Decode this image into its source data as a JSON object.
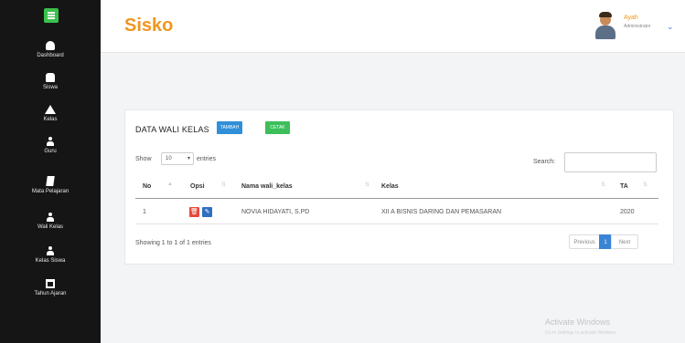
{
  "app": {
    "brand": "Sisko"
  },
  "user": {
    "name": "Ayah",
    "role": "Administrator"
  },
  "sidebar": {
    "items": [
      {
        "label": "Dashboard",
        "icon": "dashboard-icon"
      },
      {
        "label": "Siswa",
        "icon": "users-icon"
      },
      {
        "label": "Kelas",
        "icon": "home-icon"
      },
      {
        "label": "Guru",
        "icon": "user-icon"
      },
      {
        "label": "Mata Pelajaran",
        "icon": "book-icon"
      },
      {
        "label": "Wali Kelas",
        "icon": "user-icon"
      },
      {
        "label": "Kelas Siswa",
        "icon": "user-icon"
      },
      {
        "label": "Tahun Ajaran",
        "icon": "calendar-icon"
      }
    ]
  },
  "card": {
    "title": "DATA WALI KELAS",
    "tambah_label": "TAMBAH",
    "cetak_label": "CETAK"
  },
  "table_controls": {
    "show_label": "Show",
    "entries_value": "10",
    "entries_label": "entries",
    "search_label": "Search:"
  },
  "table": {
    "columns": [
      "No",
      "Opsi",
      "Nama wali_kelas",
      "Kelas",
      "TA"
    ],
    "rows": [
      {
        "no": "1",
        "nama": "NOVIA HIDAYATI, S.PD",
        "kelas": "XII A BISNIS DARING DAN PEMASARAN",
        "ta": "2020"
      }
    ]
  },
  "footer": {
    "info": "Showing 1 to 1 of 1 entries",
    "previous": "Previous",
    "current_page": "1",
    "next": "Next"
  },
  "watermark": {
    "title": "Activate Windows",
    "subtitle": "Go to Settings to activate Windows."
  },
  "colors": {
    "brand": "#f0961e",
    "sidebar": "#151515",
    "primary": "#2f8fd8",
    "success": "#3cbf5a",
    "danger": "#e74a3b"
  }
}
